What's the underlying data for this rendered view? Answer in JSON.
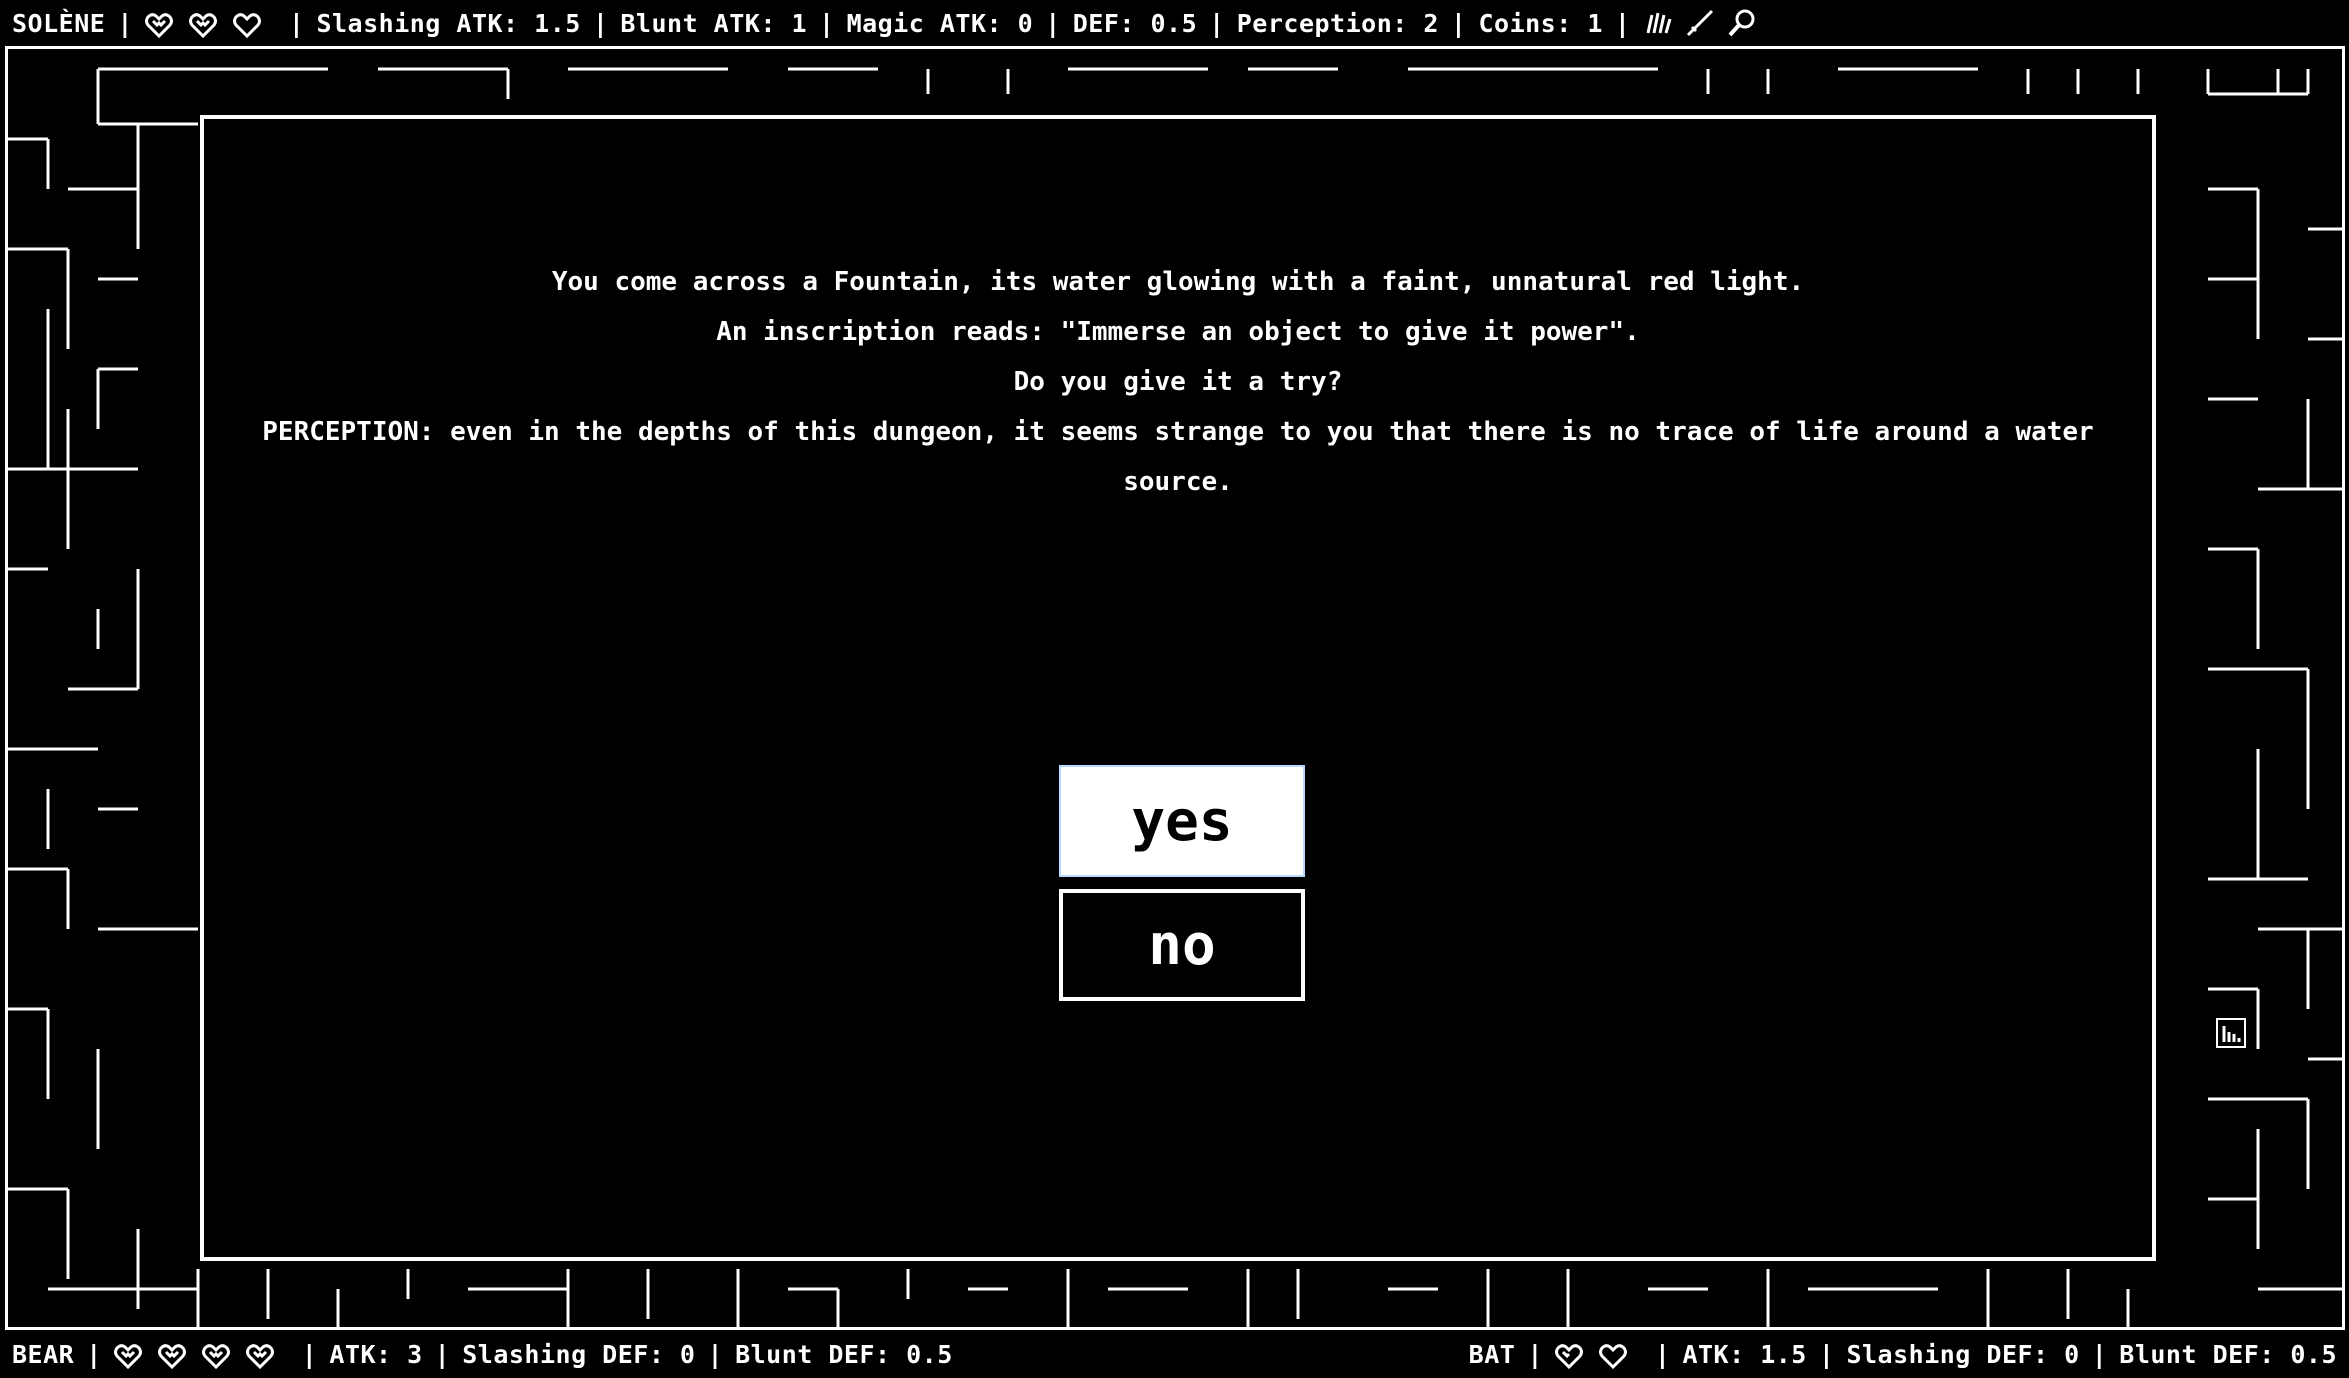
{
  "player": {
    "name": "SOLÈNE",
    "hearts": [
      "full",
      "full",
      "empty"
    ],
    "stats": [
      "Slashing ATK: 1.5",
      "Blunt ATK: 1",
      "Magic ATK: 0",
      "DEF: 0.5",
      "Perception: 2",
      "Coins: 1"
    ],
    "items": [
      "claw-icon",
      "sword-icon",
      "magnifier-icon"
    ],
    "separator": "|"
  },
  "dialog": {
    "lines": [
      "You come across a Fountain, its water glowing with a faint, unnatural red light.",
      "An inscription reads: \"Immerse an object to give it power\".",
      "Do you give it a try?",
      "PERCEPTION: even in the depths of this dungeon, it seems strange to you that there is no trace of life around a water source."
    ],
    "yes_label": "yes",
    "no_label": "no"
  },
  "enemy_left": {
    "name": "BEAR",
    "hearts": [
      "full",
      "full",
      "full",
      "full"
    ],
    "stats": [
      "ATK: 3",
      "Slashing DEF: 0",
      "Blunt DEF: 0.5"
    ]
  },
  "enemy_right": {
    "name": "BAT",
    "hearts": [
      "half",
      "empty"
    ],
    "stats": [
      "ATK: 1.5",
      "Slashing DEF: 0",
      "Blunt DEF: 0.5"
    ]
  },
  "colors": {
    "background": "#000000",
    "foreground": "#ffffff",
    "yes_border": "#b8d8ff"
  }
}
